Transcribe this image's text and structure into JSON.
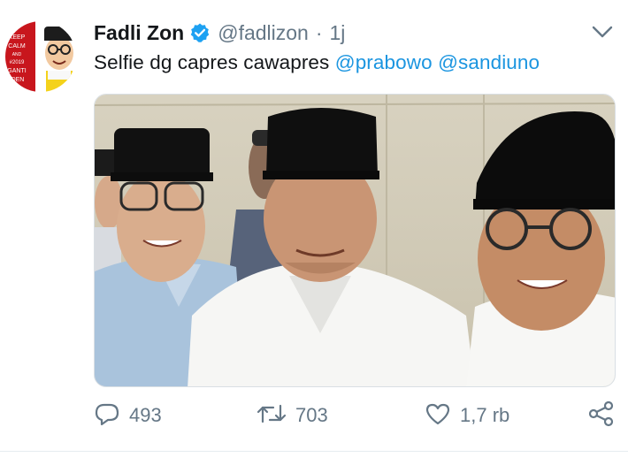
{
  "avatar": {
    "sign_lines": [
      "KEEP",
      "CALM",
      "AND",
      "#2019",
      "GANTI",
      "IDEN"
    ]
  },
  "tweet": {
    "author_name": "Fadli Zon",
    "author_handle": "@fadlizon",
    "separator": "·",
    "time": "1j",
    "text_plain": "Selfie dg capres cawapres ",
    "mention_1": "@prabowo",
    "mention_2": "@sandiuno",
    "space": " "
  },
  "actions": {
    "reply_count": "493",
    "retweet_count": "703",
    "like_count": "1,7 rb"
  },
  "colors": {
    "text": "#14171a",
    "secondary": "#657786",
    "link": "#1b95e0",
    "verified": "#1da1f2"
  },
  "icons": [
    "verified-badge-icon",
    "chevron-down-icon",
    "reply-icon",
    "retweet-icon",
    "like-icon",
    "share-icon"
  ]
}
